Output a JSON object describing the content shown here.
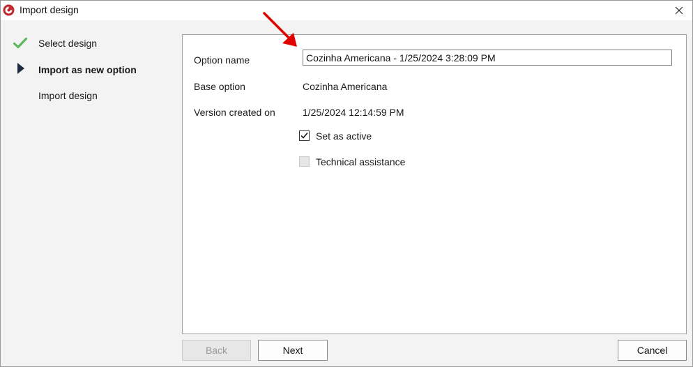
{
  "window": {
    "title": "Import design"
  },
  "steps": [
    {
      "label": "Select design",
      "state": "done",
      "icon": "checkmark-icon"
    },
    {
      "label": "Import as new option",
      "state": "current",
      "icon": "play-arrow-icon"
    },
    {
      "label": "Import design",
      "state": "pending",
      "icon": ""
    }
  ],
  "form": {
    "option_name_label": "Option name",
    "option_name_value": "Cozinha Americana - 1/25/2024 3:28:09 PM",
    "base_option_label": "Base option",
    "base_option_value": "Cozinha Americana",
    "version_created_label": "Version created on",
    "version_created_value": "1/25/2024 12:14:59 PM",
    "set_active_label": "Set as active",
    "set_active_checked": true,
    "technical_assistance_label": "Technical assistance",
    "technical_assistance_checked": false
  },
  "buttons": {
    "back": "Back",
    "next": "Next",
    "cancel": "Cancel"
  },
  "colors": {
    "check_green": "#5cb85c",
    "annotation_red": "#e00000",
    "logo_red": "#c0272d"
  }
}
